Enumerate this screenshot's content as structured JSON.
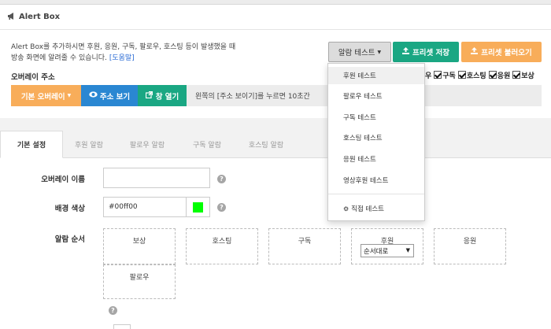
{
  "header": {
    "icon": "megaphone-icon",
    "title": "Alert Box"
  },
  "intro": {
    "line1": "Alert Box를 추가하시면 후원, 응원, 구독, 팔로우, 호스팅 등이 발생했을 때",
    "line2": "방송 화면에 알려줄 수 있습니다.",
    "help_link": "[도움말]"
  },
  "toolbar": {
    "alarm_test_label": "알람 테스트",
    "save_preset_label": "프리셋 저장",
    "load_preset_label": "프리셋 불러오기"
  },
  "overlay_address": {
    "label": "오버레이 주소",
    "basic_overlay_label": "기본 오버레이",
    "view_address_label": "주소 보기",
    "open_window_label": "창 열기",
    "hint": "왼쪽의 [주소 보이기]를 누르면 10초간"
  },
  "alert_toggles": [
    {
      "label": "우",
      "checked": true
    },
    {
      "label": "구독",
      "checked": true
    },
    {
      "label": "호스팅",
      "checked": true
    },
    {
      "label": "응원",
      "checked": true
    },
    {
      "label": "보상",
      "checked": true
    }
  ],
  "tabs": [
    "기본 설정",
    "후원 알람",
    "팔로우 알람",
    "구독 알람",
    "호스팅 알람"
  ],
  "form": {
    "overlay_name_label": "오버레이 이름",
    "overlay_name_value": "",
    "bg_color_label": "배경 색상",
    "bg_color_value": "#00ff00",
    "alarm_order_label": "알람 순서",
    "order_boxes": [
      "보상",
      "호스팅",
      "구독",
      "후원",
      "응원",
      "팔로우"
    ],
    "order_select_value": "순서대로"
  },
  "dropdown": {
    "items": [
      "후원 테스트",
      "팔로우 테스트",
      "구독 테스트",
      "호스팅 테스트",
      "응원 테스트",
      "영상후원 테스트"
    ],
    "direct_test_label": "직접 테스트"
  },
  "colors": {
    "green": "#1aa783",
    "orange": "#f8ad5a",
    "blue": "#2a87d2",
    "swatch": "#00ff00"
  }
}
